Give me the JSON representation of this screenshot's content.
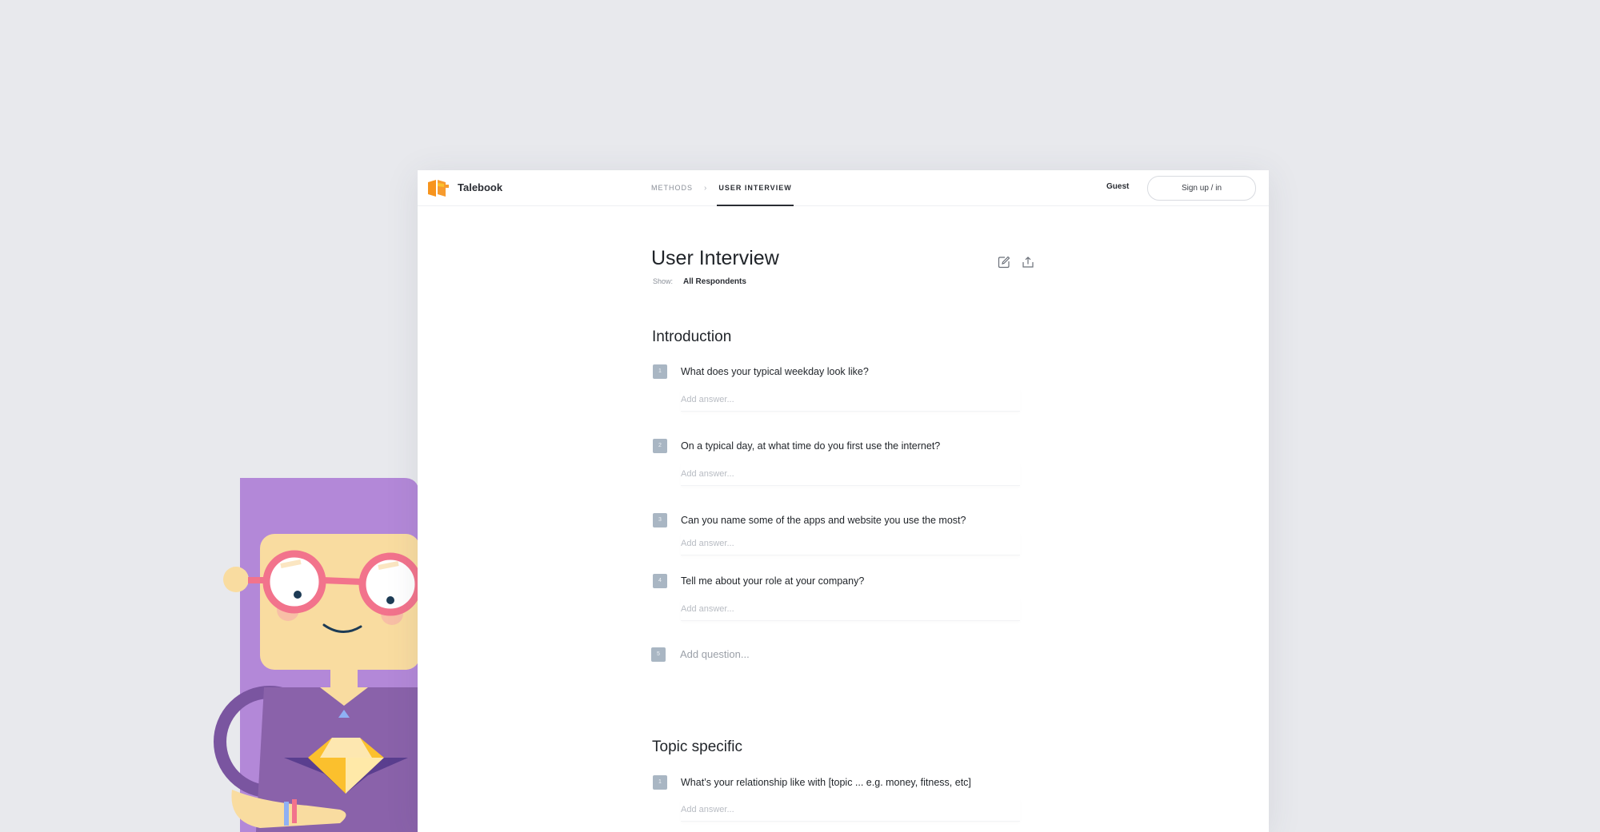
{
  "app": {
    "name": "Talebook",
    "brand_color": "#f7941d",
    "logo_icon": "talebook-logo-icon"
  },
  "nav": {
    "breadcrumb": [
      "METHODS",
      "USER INTERVIEW"
    ],
    "separator": "›",
    "guest_label": "Guest",
    "signup_label": "Sign up / in"
  },
  "page": {
    "title": "User Interview",
    "show_label": "Show:",
    "show_value": "All Respondents",
    "edit_icon": "edit-icon",
    "share_icon": "share-icon"
  },
  "sections": [
    {
      "title": "Introduction",
      "questions": [
        {
          "number": "1",
          "text": "What does your typical weekday look like?",
          "answer_placeholder": "Add answer..."
        },
        {
          "number": "2",
          "text": "On a typical day, at what time do you first use the internet?",
          "answer_placeholder": "Add answer..."
        },
        {
          "number": "3",
          "text": "Can you name some of the apps and website you use the most?",
          "answer_placeholder": "Add answer..."
        },
        {
          "number": "4",
          "text": "Tell me about your role at your company?",
          "answer_placeholder": "Add answer..."
        }
      ],
      "add_question": {
        "number": "5",
        "placeholder": "Add question..."
      }
    },
    {
      "title": "Topic specific",
      "questions": [
        {
          "number": "1",
          "text": "What’s your relationship like with [topic ... e.g. money, fitness, etc]",
          "answer_placeholder": "Add answer..."
        }
      ]
    }
  ],
  "colors": {
    "background": "#e8e9ed",
    "badge": "#a9b6c3",
    "character_hair": "#b388d8",
    "character_shirt": "#8a62aa",
    "glasses": "#f2738c",
    "gem": "#fbc02d"
  }
}
